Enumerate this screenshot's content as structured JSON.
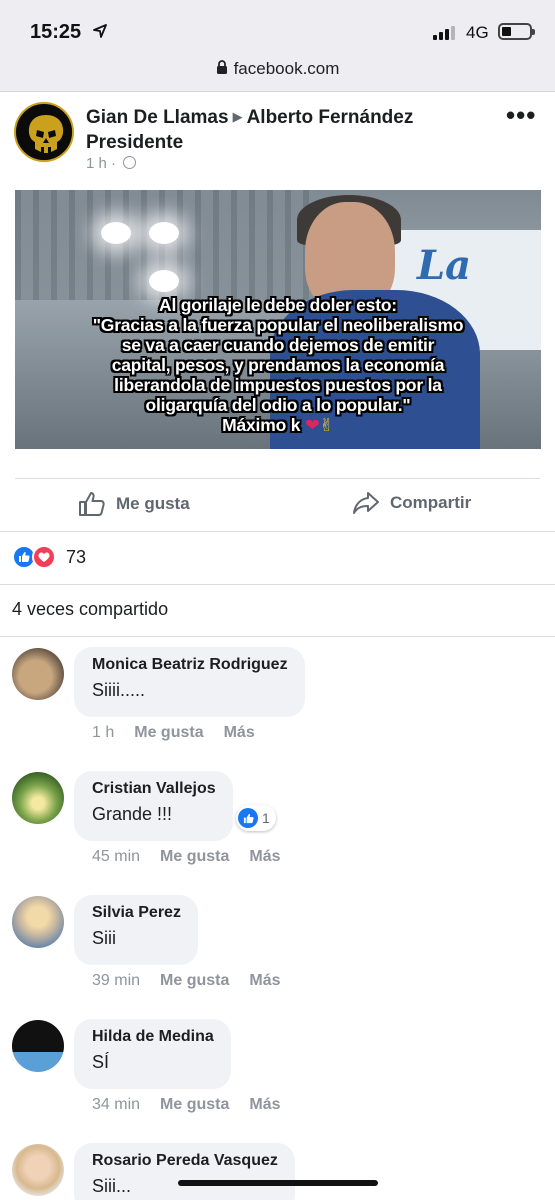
{
  "status_bar": {
    "time": "15:25",
    "network": "4G"
  },
  "browser": {
    "domain": "facebook.com"
  },
  "post": {
    "author": "Gian De Llamas",
    "target_page": "Alberto Fernández Presidente",
    "time": "1 h",
    "visibility_icon": "globe-icon",
    "image_caption_lines": [
      "Al gorilaje le debe doler esto:",
      "\"Gracias a la fuerza popular el neoliberalismo",
      "se va a caer cuando dejemos de emitir",
      "capital, pesos, y prendamos la economía",
      "liberandola de impuestos puestos por la",
      "oligarquía del odio a lo popular.\""
    ],
    "image_signature": "Máximo k",
    "image_background_text": "La"
  },
  "actions": {
    "like_label": "Me gusta",
    "share_label": "Compartir"
  },
  "reactions": {
    "count": "73",
    "types": [
      "like",
      "love"
    ]
  },
  "shares_text": "4 veces compartido",
  "comments": [
    {
      "name": "Monica Beatriz Rodriguez",
      "text": "Siiii.....",
      "time": "1 h",
      "like": "Me gusta",
      "more": "Más"
    },
    {
      "name": "Cristian Vallejos",
      "text": "Grande !!!",
      "time": "45 min",
      "like": "Me gusta",
      "more": "Más",
      "reaction_count": "1"
    },
    {
      "name": "Silvia Perez",
      "text": "Siii",
      "time": "39 min",
      "like": "Me gusta",
      "more": "Más"
    },
    {
      "name": "Hilda de Medina",
      "text": "SÍ",
      "time": "34 min",
      "like": "Me gusta",
      "more": "Más"
    },
    {
      "name": "Rosario Pereda Vasquez",
      "text": "Siii..."
    }
  ],
  "colors": {
    "facebook_blue": "#1877f2",
    "love_red": "#f33e58",
    "bubble_gray": "#f0f2f5",
    "meta_gray": "#90949c"
  }
}
